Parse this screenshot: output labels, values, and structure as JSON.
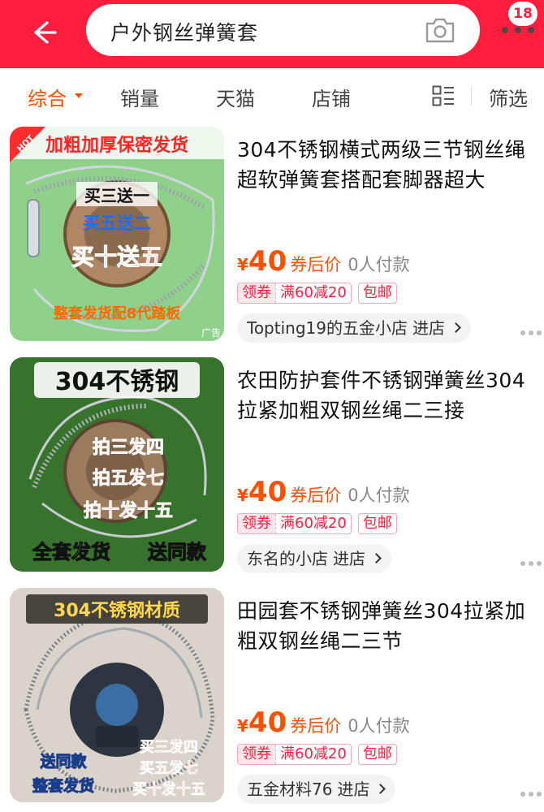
{
  "header": {
    "search_query": "户外钢丝弹簧套",
    "message_badge": "18",
    "back_icon": "back-arrow-icon",
    "camera_icon": "camera-icon",
    "more_icon": "more-dots-icon",
    "color": "#ff1f3d"
  },
  "filters": {
    "tabs": [
      {
        "label": "综合",
        "active": true
      },
      {
        "label": "销量",
        "active": false
      },
      {
        "label": "天猫",
        "active": false
      },
      {
        "label": "店铺",
        "active": false
      }
    ],
    "view_toggle_icon": "list-view-icon",
    "filter_label": "筛选",
    "accent": "#ff5000"
  },
  "products": [
    {
      "title": "304不锈钢横式两级三节钢丝绳超软弹簧套搭配套脚器超大",
      "currency": "¥",
      "price": "40",
      "price_tag": "券后价",
      "paid_count": "0人付款",
      "coupon_label": "领券",
      "coupon_value": "满60减20",
      "shipping": "包邮",
      "shop": "Topting19的五金小店",
      "enter": "进店",
      "image": {
        "hot": "HOT",
        "banner": "加粗加厚保密发货",
        "promo1": "买三送一",
        "promo2": "买五送二",
        "promo3": "买十送五",
        "bottom": "整套发货配8代踏板",
        "ad": "广告"
      }
    },
    {
      "title": "农田防护套件不锈钢弹簧丝304拉紧加粗双钢丝绳二三接",
      "currency": "¥",
      "price": "40",
      "price_tag": "券后价",
      "paid_count": "0人付款",
      "coupon_label": "领券",
      "coupon_value": "满60减20",
      "shipping": "包邮",
      "shop": "东名的小店",
      "enter": "进店",
      "image": {
        "banner": "304不锈钢",
        "promo1": "拍三发四",
        "promo2": "拍五发七",
        "promo3": "拍十发十五",
        "bottom_left": "全套发货",
        "bottom_right": "送同款"
      }
    },
    {
      "title": "田园套不锈钢弹簧丝304拉紧加粗双钢丝绳二三节",
      "currency": "¥",
      "price": "40",
      "price_tag": "券后价",
      "paid_count": "0人付款",
      "coupon_label": "领券",
      "coupon_value": "满60减20",
      "shipping": "包邮",
      "shop": "五金材料76",
      "enter": "进店",
      "image": {
        "banner": "304不锈钢材质",
        "left1": "送同款",
        "left2": "整套发货",
        "promo1": "买三发四",
        "promo2": "买五发七",
        "promo3": "买十发十五"
      }
    }
  ]
}
